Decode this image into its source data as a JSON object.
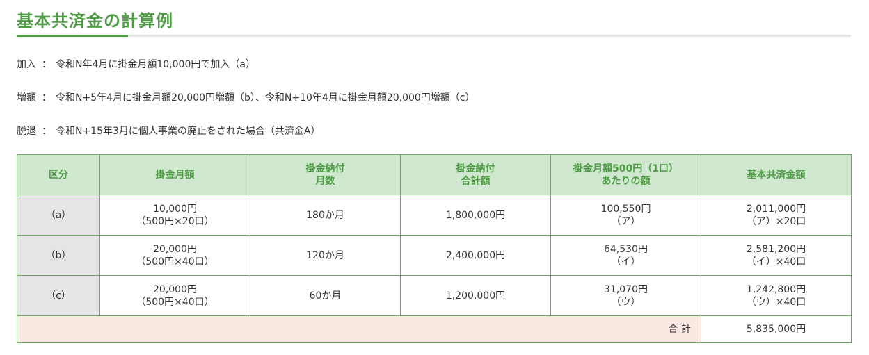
{
  "title": "基本共済金の計算例",
  "info": [
    {
      "label": "加入",
      "sep": "：",
      "text": "令和N年4月に掛金月額10,000円で加入（a）"
    },
    {
      "label": "増額",
      "sep": "：",
      "text": "令和N+5年4月に掛金月額20,000円増額（b）、令和N+10年4月に掛金月額20,000円増額（c）"
    },
    {
      "label": "脱退",
      "sep": "：",
      "text": "令和N+15年3月に個人事業の廃止をされた場合（共済金A）"
    }
  ],
  "table": {
    "headers": [
      [
        "区分"
      ],
      [
        "掛金月額"
      ],
      [
        "掛金納付",
        "月数"
      ],
      [
        "掛金納付",
        "合計額"
      ],
      [
        "掛金月額500円（1口）",
        "あたりの額"
      ],
      [
        "基本共済金額"
      ]
    ],
    "rows": [
      {
        "label": "（a）",
        "monthly": [
          "10,000円",
          "（500円×20口）"
        ],
        "months": "180か月",
        "paid_total": "1,800,000円",
        "per_unit": [
          "100,550円",
          "（ア）"
        ],
        "benefit": [
          "2,011,000円",
          "（ア）×20口"
        ]
      },
      {
        "label": "（b）",
        "monthly": [
          "20,000円",
          "（500円×40口）"
        ],
        "months": "120か月",
        "paid_total": "2,400,000円",
        "per_unit": [
          "64,530円",
          "（イ）"
        ],
        "benefit": [
          "2,581,200円",
          "（イ）×40口"
        ]
      },
      {
        "label": "（c）",
        "monthly": [
          "20,000円",
          "（500円×40口）"
        ],
        "months": "60か月",
        "paid_total": "1,200,000円",
        "per_unit": [
          "31,070円",
          "（ウ）"
        ],
        "benefit": [
          "1,242,800円",
          "（ウ）×40口"
        ]
      }
    ],
    "total_label": "合 計",
    "total_value": "5,835,000円"
  },
  "colors": {
    "accent": "#4f9b46",
    "header_bg": "#cfe8cf",
    "row_label_bg": "#e5e5e8",
    "total_bg": "#fbe8e2",
    "border": "#6aa75f"
  }
}
